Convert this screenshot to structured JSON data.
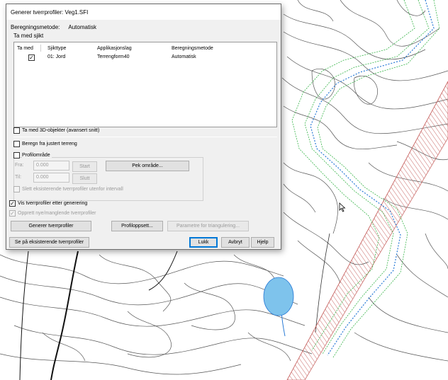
{
  "dialog": {
    "title": "Generer tverrprofiler: Veg1.SFI",
    "method_label": "Beregningsmetode:",
    "method_value": "Automatisk",
    "group_label": "Ta med sjikt",
    "table": {
      "columns": [
        "Ta med",
        "Sjikttype",
        "Applikasjonslag",
        "Beregningsmetode"
      ],
      "rows": [
        {
          "include": true,
          "type": "01: Jord",
          "layer": "Terrengform40",
          "method": "Automatisk"
        }
      ]
    },
    "include_3d_label": "Ta med 3D-objekter (avansert snitt)",
    "include_3d_checked": false,
    "adjusted_terrain_label": "Beregn fra justert terreng",
    "adjusted_terrain_checked": false,
    "profile_range": {
      "label": "Profilområde",
      "checked": false,
      "from_label": "Fra:",
      "from_value": "0.000",
      "start_button": "Start",
      "to_label": "Til:",
      "to_value": "0.000",
      "end_button": "Slutt",
      "pick_button": "Pek område...",
      "delete_outside_label": "Slett eksisterende tverrprofiler utenfor intervall"
    },
    "show_after_label": "Vis tverrprofiler etter generering",
    "show_after_checked": true,
    "create_missing_label": "Opprett nye/manglende tverrprofiler",
    "create_missing_checked": true,
    "generate_button": "Generer tverrprofiler",
    "profile_setup_button": "Profiloppsett...",
    "triangulation_button": "Parametre for triangulering...",
    "see_existing_button": "Se på eksisterende tverrprofiler",
    "close_button": "Lukk",
    "cancel_button": "Avbryt",
    "help_button": "Hjelp"
  },
  "map": {
    "lake_color": "#7ec3ec",
    "road_corridor_color": "#c0504d",
    "profile_line_color": "#2a7bd6",
    "cross_section_color": "#39b54a"
  }
}
